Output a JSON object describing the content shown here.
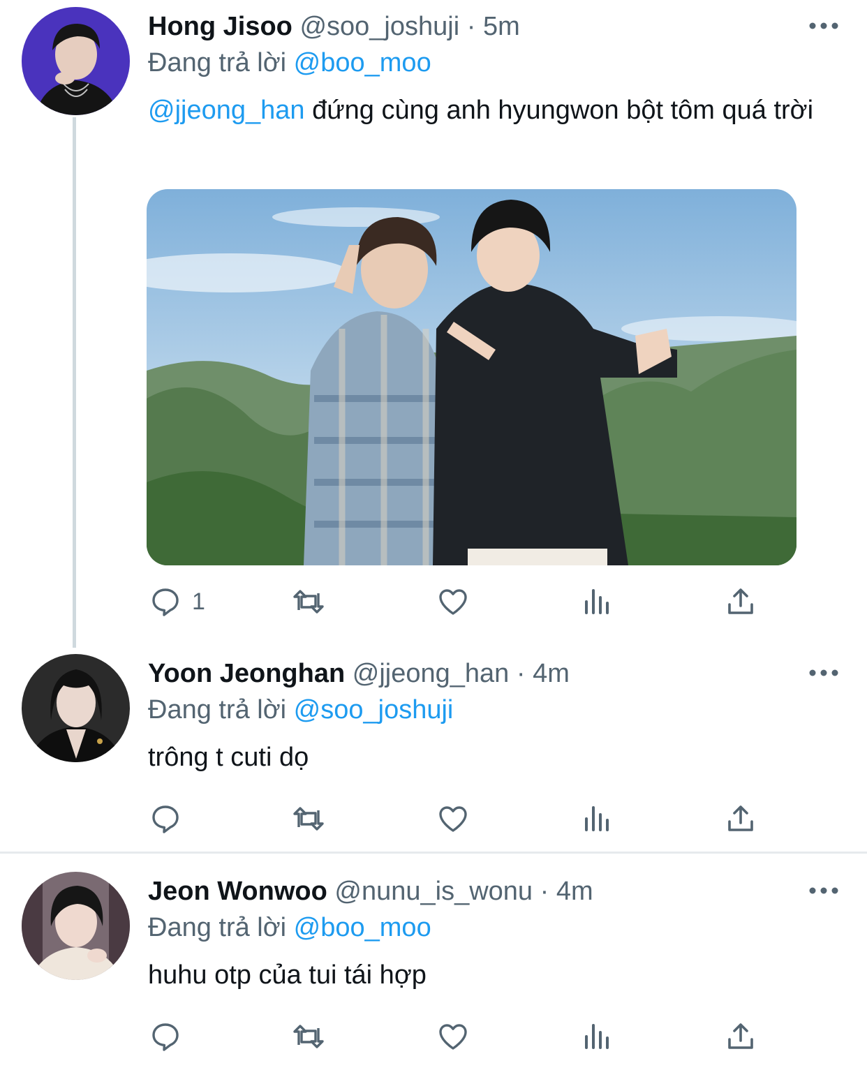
{
  "tweets": [
    {
      "name": "Hong Jisoo",
      "handle": "@soo_joshuji",
      "separator": "·",
      "time": "5m",
      "replying_prefix": "Đang trả lời",
      "replying_to": "@boo_moo",
      "text_mention": "@jjeong_han",
      "text": " đứng cùng anh hyungwon bột tôm quá trời",
      "reply_count": "1",
      "avatar_colors": {
        "bg": "#5b3ee0",
        "hair": "#1a1a1a",
        "skin": "#e8cfc0"
      }
    },
    {
      "name": "Yoon Jeonghan",
      "handle": "@jjeong_han",
      "separator": "·",
      "time": "4m",
      "replying_prefix": "Đang trả lời",
      "replying_to": "@soo_joshuji",
      "text_mention": "",
      "text": "trông t cuti dọ",
      "reply_count": "",
      "avatar_colors": {
        "bg": "#2b2b2b",
        "hair": "#111111",
        "skin": "#ead8cf"
      }
    },
    {
      "name": "Jeon Wonwoo",
      "handle": "@nunu_is_wonu",
      "separator": "·",
      "time": "4m",
      "replying_prefix": "Đang trả lời",
      "replying_to": "@boo_moo",
      "text_mention": "",
      "text": "huhu otp của tui tái hợp",
      "reply_count": "",
      "avatar_colors": {
        "bg": "#7a6a72",
        "hair": "#161616",
        "skin": "#efd9cf"
      }
    }
  ],
  "icons": {
    "reply": "reply-icon",
    "retweet": "retweet-icon",
    "like": "heart-icon",
    "views": "analytics-icon",
    "share": "share-icon",
    "more": "more-icon"
  },
  "colors": {
    "accent": "#1d9bf0",
    "secondary_text": "#536471",
    "icon": "#536471",
    "thread_line": "#cfd9de"
  }
}
